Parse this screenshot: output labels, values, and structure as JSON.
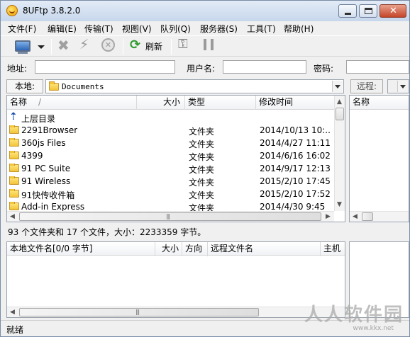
{
  "window": {
    "title": "8UFtp 3.8.2.0"
  },
  "menu": [
    "文件(F)",
    "编辑(E)",
    "传输(T)",
    "视图(V)",
    "队列(Q)",
    "服务器(S)",
    "工具(T)",
    "帮助(H)"
  ],
  "toolbar": {
    "refresh_label": "刷新"
  },
  "connect": {
    "address_label": "地址:",
    "username_label": "用户名:",
    "password_label": "密码:",
    "address_value": "",
    "username_value": "",
    "password_value": ""
  },
  "local": {
    "label": "本地:",
    "path": "Documents",
    "columns": [
      "名称",
      "大小",
      "类型",
      "修改时间"
    ],
    "sort_indicator": "/",
    "parent_dir": "上层目录",
    "rows": [
      {
        "name": "2291Browser",
        "size": "",
        "type": "文件夹",
        "modified": "2014/10/13 10:..."
      },
      {
        "name": "360js Files",
        "size": "",
        "type": "文件夹",
        "modified": "2014/4/27 11:11"
      },
      {
        "name": "4399",
        "size": "",
        "type": "文件夹",
        "modified": "2014/6/16 16:02"
      },
      {
        "name": "91 PC Suite",
        "size": "",
        "type": "文件夹",
        "modified": "2014/9/17 12:13"
      },
      {
        "name": "91 Wireless",
        "size": "",
        "type": "文件夹",
        "modified": "2015/2/10 17:45"
      },
      {
        "name": "91快传收件箱",
        "size": "",
        "type": "文件夹",
        "modified": "2015/2/10 17:52"
      },
      {
        "name": "Add-in Express",
        "size": "",
        "type": "文件夹",
        "modified": "2014/4/30 9:45"
      }
    ],
    "status": "93 个文件夹和 17 个文件，大小：2233359 字节。"
  },
  "remote": {
    "label": "远程:",
    "columns": [
      "名称"
    ]
  },
  "queue": {
    "columns": [
      "本地文件名[0/0 字节]",
      "大小",
      "方向",
      "远程文件名",
      "主机"
    ]
  },
  "statusbar": {
    "text": "就绪"
  },
  "watermark": {
    "text": "人人软件园",
    "url": "www.kkx.net"
  }
}
